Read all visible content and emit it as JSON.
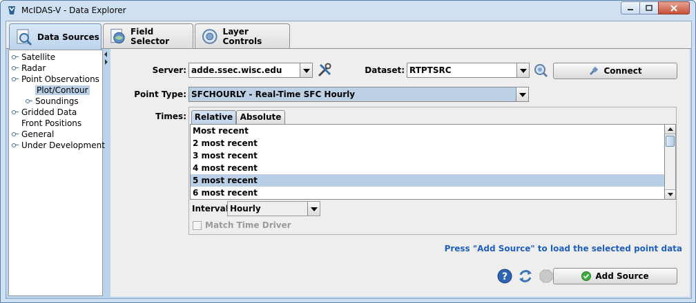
{
  "window": {
    "title": "McIDAS-V - Data Explorer",
    "minimize_glyph": "—",
    "maximize_glyph": "□",
    "close_glyph": "✕"
  },
  "tabs": [
    {
      "label": "Data Sources",
      "icon": "data-sources-icon",
      "selected": true
    },
    {
      "label": "Field Selector",
      "icon": "field-selector-icon",
      "selected": false
    },
    {
      "label": "Layer Controls",
      "icon": "layer-controls-icon",
      "selected": false
    }
  ],
  "tree": {
    "items": [
      {
        "label": "Satellite"
      },
      {
        "label": "Radar"
      },
      {
        "label": "Point Observations"
      },
      {
        "label": "Plot/Contour",
        "selected": true
      },
      {
        "label": "Soundings"
      },
      {
        "label": "Gridded Data"
      },
      {
        "label": "Front Positions"
      },
      {
        "label": "General"
      },
      {
        "label": "Under Development"
      }
    ]
  },
  "form": {
    "server_label": "Server:",
    "server_value": "adde.ssec.wisc.edu",
    "dataset_label": "Dataset:",
    "dataset_value": "RTPTSRC",
    "connect_label": "Connect",
    "point_type_label": "Point Type:",
    "point_type_value": "SFCHOURLY - Real-Time SFC Hourly",
    "times_label": "Times:",
    "times_tabs": [
      "Relative",
      "Absolute"
    ],
    "times_list": [
      "Most recent",
      "2 most recent",
      "3 most recent",
      "4 most recent",
      "5 most recent",
      "6 most recent"
    ],
    "selected_time_index": 4,
    "interval_label": "Interval:",
    "interval_value": "Hourly",
    "match_time_driver_label": "Match Time Driver",
    "match_time_driver_checked": false,
    "hint": "Press \"Add Source\" to load the selected point data",
    "add_source_label": "Add Source"
  },
  "colors": {
    "accent": "#1f5fbf",
    "selection": "#b8cfe6",
    "tab_selected": "#bcd3ec"
  }
}
